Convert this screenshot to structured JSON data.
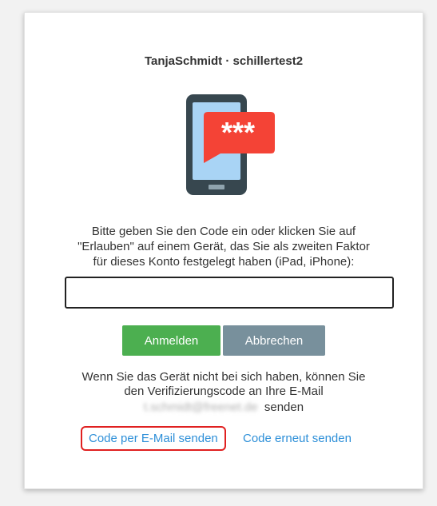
{
  "account": {
    "title": "TanjaSchmidt · schillertest2"
  },
  "illustration": {
    "icon": "phone-sms-code-icon",
    "bubble_text": "***",
    "phone_color": "#37474f",
    "screen_color": "#a9d4f5",
    "bubble_color": "#f44336"
  },
  "instructions": {
    "text": "Bitte geben Sie den Code ein oder klicken Sie auf\n\"Erlauben\" auf einem Gerät, das Sie als zweiten Faktor\nfür dieses Konto festgelegt haben (iPad, iPhone):"
  },
  "code_input": {
    "value": "",
    "placeholder": ""
  },
  "buttons": {
    "login_label": "Anmelden",
    "login_color": "#4caf50",
    "cancel_label": "Abbrechen",
    "cancel_color": "#78909c"
  },
  "fallback": {
    "text": "Wenn Sie das Gerät nicht bei sich haben, können Sie\nden Verifizierungscode an Ihre E-Mail",
    "masked_email": "t.schmidt@freenet.de",
    "suffix": "senden"
  },
  "links": {
    "send_email_label": "Code per E-Mail senden",
    "resend_label": "Code erneut senden",
    "link_color": "#2d8fd8",
    "highlight_color": "#e02020"
  }
}
